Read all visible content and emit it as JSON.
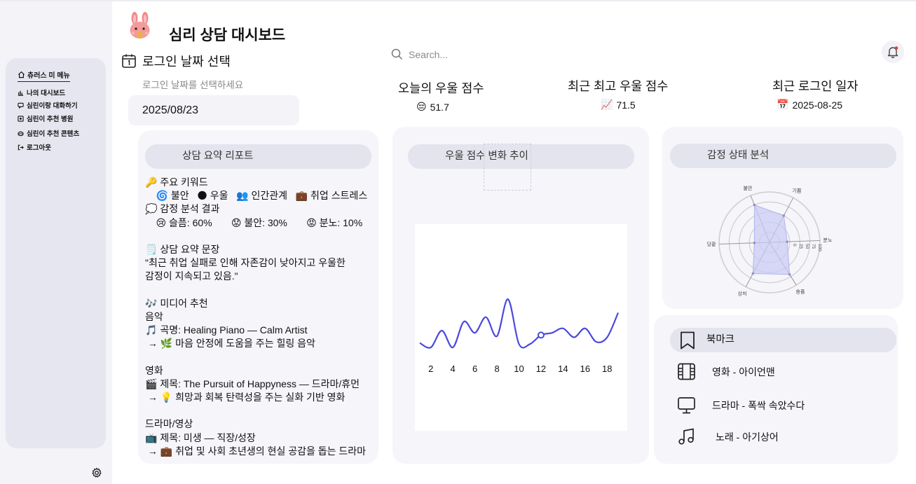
{
  "app": {
    "title": "심리 상담 대시보드"
  },
  "sidebar": {
    "title": "츄러스 미 메뉴",
    "items": [
      {
        "label": "나의 대시보드",
        "icon": "bar-chart-icon"
      },
      {
        "label": "심린이랑 대화하기",
        "icon": "chat-bubble-icon"
      },
      {
        "label": "심린이 추천 병원",
        "icon": "hospital-icon"
      },
      {
        "label": "심린이 추천 콘텐츠",
        "icon": "content-icon"
      },
      {
        "label": "로그아웃",
        "icon": "logout-icon"
      }
    ]
  },
  "date_select": {
    "title": "로그인 날짜 선택",
    "hint": "로그인 날짜를 선택하세요",
    "value": "2025/08/23"
  },
  "search": {
    "placeholder": "Search..."
  },
  "stats": [
    {
      "label": "오늘의 우울 점수",
      "emoji": "😔",
      "value": "51.7"
    },
    {
      "label": "최근 최고 우울 점수",
      "emoji": "📈",
      "value": "71.5"
    },
    {
      "label": "최근 로그인 일자",
      "emoji": "📅",
      "value": "2025-08-25"
    }
  ],
  "report": {
    "title": "상담 요약 리포트",
    "lines": [
      "🔑 주요 키워드",
      "    🌀 불안   🌑 우울   👥 인간관계   💼 취업 스트레스",
      "💭 감정 분석 결과",
      "    😢 슬픔: 60%       😟 불안: 30%       😡 분노: 10%",
      "",
      "🗒️ 상담 요약 문장",
      "\"최근 취업 실패로 인해 자존감이 낮아지고 우울한",
      "감정이 지속되고 있음.\"",
      "",
      "🎶 미디어 추천",
      "음악",
      "🎵 곡명: Healing Piano — Calm Artist",
      " → 🌿 마음 안정에 도움을 주는 힐링 음악",
      "",
      "영화",
      "🎬 제목: The Pursuit of Happyness — 드라마/휴먼",
      " → 💡 희망과 회복 탄력성을 주는 실화 기반 영화",
      "",
      "드라마/영상",
      "📺 제목: 미생 — 직장/성장",
      " → 💼 취업 및 사회 초년생의 현실 공감을 돕는 드라마"
    ]
  },
  "trend": {
    "title": "우울 점수 변화 추이",
    "x_ticks": [
      "2",
      "4",
      "6",
      "8",
      "10",
      "12",
      "14",
      "16",
      "18"
    ]
  },
  "chart_data": [
    {
      "type": "line",
      "title": "우울 점수 변화 추이",
      "x": [
        1,
        2,
        3,
        4,
        5,
        6,
        7,
        8,
        9,
        10,
        11,
        12,
        13,
        14,
        15,
        16,
        17,
        18,
        19
      ],
      "y": [
        19,
        15,
        30,
        15,
        38,
        28,
        42,
        25,
        58,
        18,
        18,
        26,
        28,
        32,
        24,
        32,
        20,
        24,
        46
      ],
      "xlim": [
        1,
        19
      ],
      "ylim": [
        0,
        100
      ],
      "x_ticks": [
        2,
        4,
        6,
        8,
        10,
        12,
        14,
        16,
        18
      ],
      "highlight_x": 12,
      "color": "#4a4ade"
    },
    {
      "type": "radar",
      "title": "감정 상태 분석",
      "axes": [
        "불안",
        "기쁨",
        "분노",
        "슬픔",
        "상처",
        "당황"
      ],
      "values": [
        80,
        60,
        35,
        75,
        70,
        30
      ],
      "rmax": 100,
      "rings": [
        20,
        40,
        60,
        80,
        100
      ],
      "ring_labels": [
        "0",
        "25",
        "50",
        "75",
        "100"
      ],
      "color": "#c9c9f5"
    }
  ],
  "emotion": {
    "title": "감정 상태 분석"
  },
  "bookmark": {
    "title": "북마크",
    "items": [
      {
        "label": "영화 - 아이언맨",
        "icon": "film-icon"
      },
      {
        "label": "드라마 -  폭싹 속았수다",
        "icon": "monitor-icon"
      },
      {
        "label": " 노래 - 아기상어",
        "icon": "music-note-icon"
      }
    ]
  }
}
